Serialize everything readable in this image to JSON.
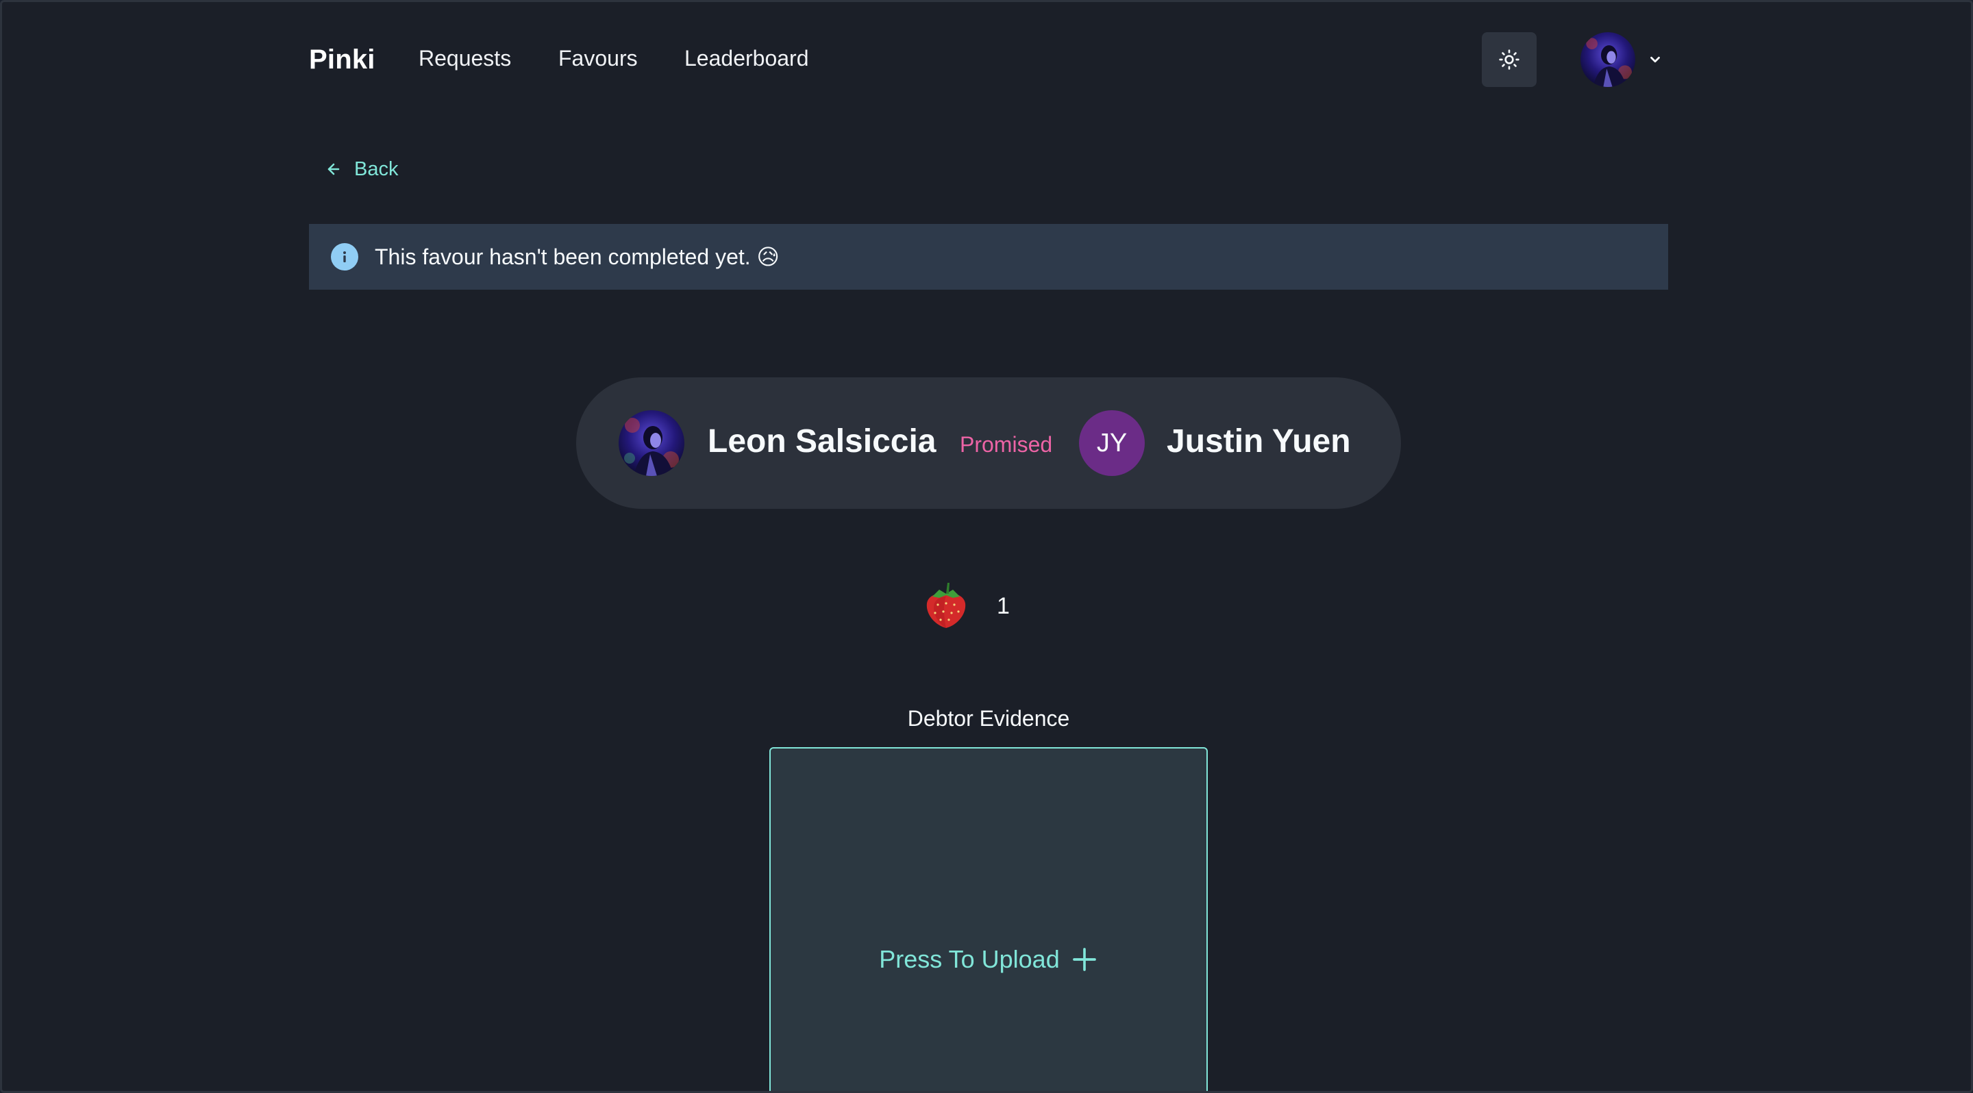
{
  "nav": {
    "brand": "Pinki",
    "links": [
      "Requests",
      "Favours",
      "Leaderboard"
    ],
    "theme_toggle_icon": "sun-icon",
    "user_menu_icon": "chevron-down-icon"
  },
  "back": {
    "label": "Back",
    "icon": "arrow-left-icon"
  },
  "alert": {
    "icon": "info-icon",
    "text": "This favour hasn't been completed yet. 😥"
  },
  "favour": {
    "debtor_name": "Leon Salsiccia",
    "status": "Promised",
    "creditor_initials": "JY",
    "creditor_name": "Justin Yuen"
  },
  "reward": {
    "icon": "strawberry-icon",
    "count": "1"
  },
  "evidence": {
    "title": "Debtor Evidence",
    "upload_label": "Press To Upload",
    "upload_icon": "plus-icon"
  },
  "colors": {
    "background": "#1b1f28",
    "accent": "#81e6d9",
    "status": "#ed64a6",
    "alert_bg": "#2e3a4b",
    "initials_bg": "#6b2c87"
  }
}
